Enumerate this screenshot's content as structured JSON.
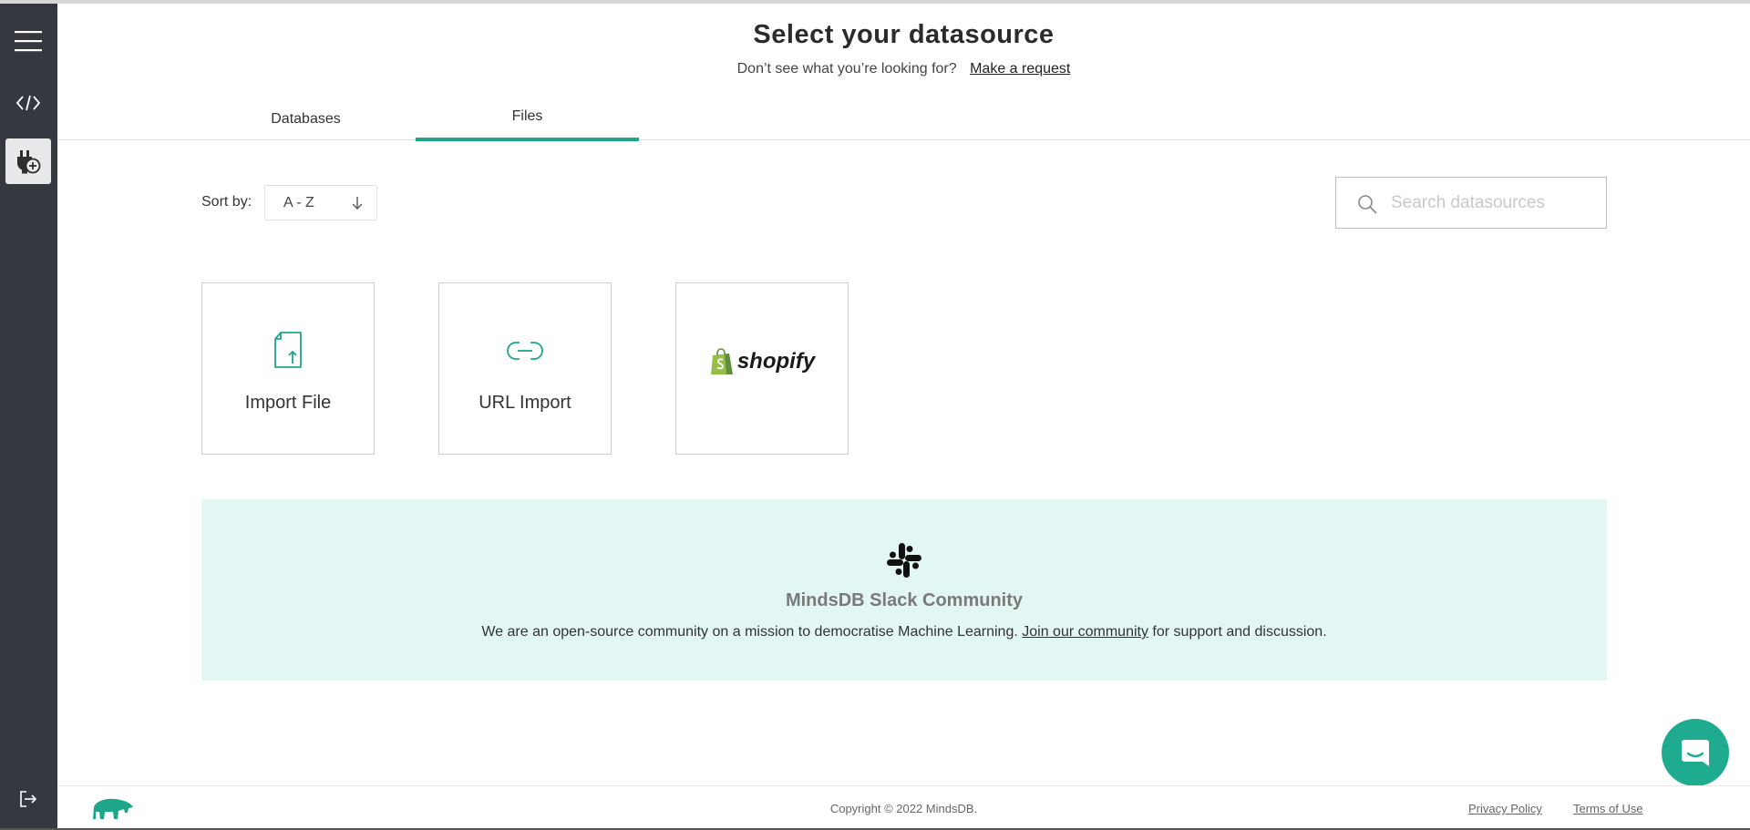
{
  "header": {
    "title": "Select your datasource",
    "subtitle": "Don’t see what you’re looking for?",
    "request_link": "Make a request"
  },
  "tabs": [
    {
      "label": "Databases",
      "active": false
    },
    {
      "label": "Files",
      "active": true
    }
  ],
  "sort": {
    "label": "Sort by:",
    "value": "A - Z"
  },
  "search": {
    "placeholder": "Search datasources"
  },
  "cards": [
    {
      "label": "Import File",
      "icon": "file-upload-icon"
    },
    {
      "label": "URL Import",
      "icon": "link-icon"
    },
    {
      "label": "shopify",
      "icon": "shopify-logo"
    }
  ],
  "community": {
    "title": "MindsDB Slack Community",
    "text_before": "We are an open-source community on a mission to democratise Machine Learning.",
    "link": "Join our community",
    "text_after": "for support and discussion."
  },
  "footer": {
    "copyright": "Copyright © 2022 MindsDB.",
    "privacy": "Privacy Policy",
    "terms": "Terms of Use"
  },
  "colors": {
    "accent": "#1ea68a",
    "sidebar": "#363840",
    "banner": "#e2f6f3",
    "shopify_green": "#95bf47"
  }
}
